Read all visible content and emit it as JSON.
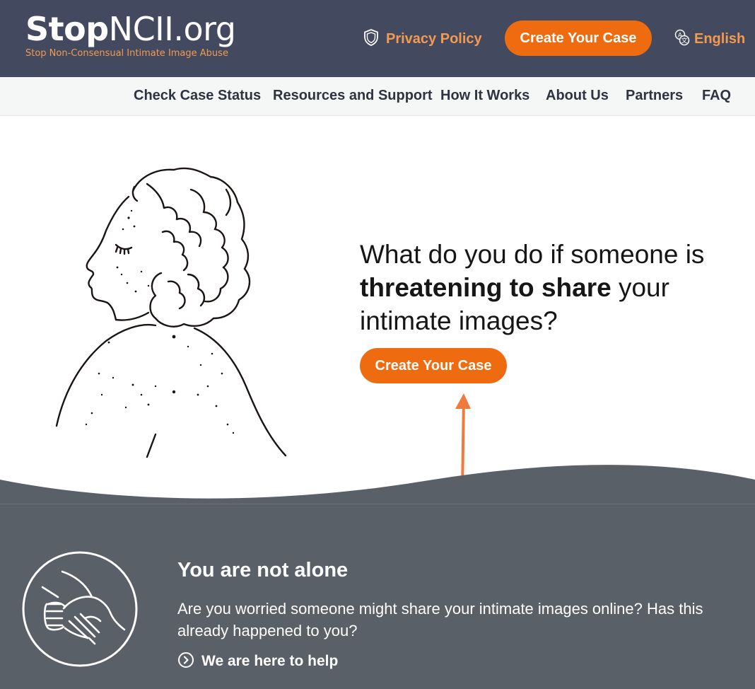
{
  "header": {
    "logo_bold": "Stop",
    "logo_light": "NCII.org",
    "tagline": "Stop Non-Consensual Intimate Image Abuse",
    "privacy_label": "Privacy Policy",
    "privacy_icon": "shield-icon",
    "cta_label": "Create Your Case",
    "language_label": "English",
    "language_icon": "translate-icon"
  },
  "nav": {
    "items": [
      {
        "label": "Check Case Status"
      },
      {
        "label": "Resources and Support"
      },
      {
        "label": "How It Works"
      },
      {
        "label": "About Us"
      },
      {
        "label": "Partners"
      },
      {
        "label": "FAQ"
      }
    ]
  },
  "hero": {
    "headline_pre": "What do you do if someone is",
    "headline_bold": "threatening to share",
    "headline_post": "your intimate images?",
    "cta_label": "Create Your Case"
  },
  "band": {
    "title": "You are not alone",
    "text": "Are you worried someone might share your intimate images online? Has this already happened to you?",
    "link_label": "We are here to help",
    "link_icon": "chevron-circle-icon",
    "illustration_icon": "helping-hands-icon"
  },
  "colors": {
    "header_bg": "#434a60",
    "accent": "#ee6b10",
    "accent_text": "#f39a50",
    "band_bg": "#5a6067"
  }
}
